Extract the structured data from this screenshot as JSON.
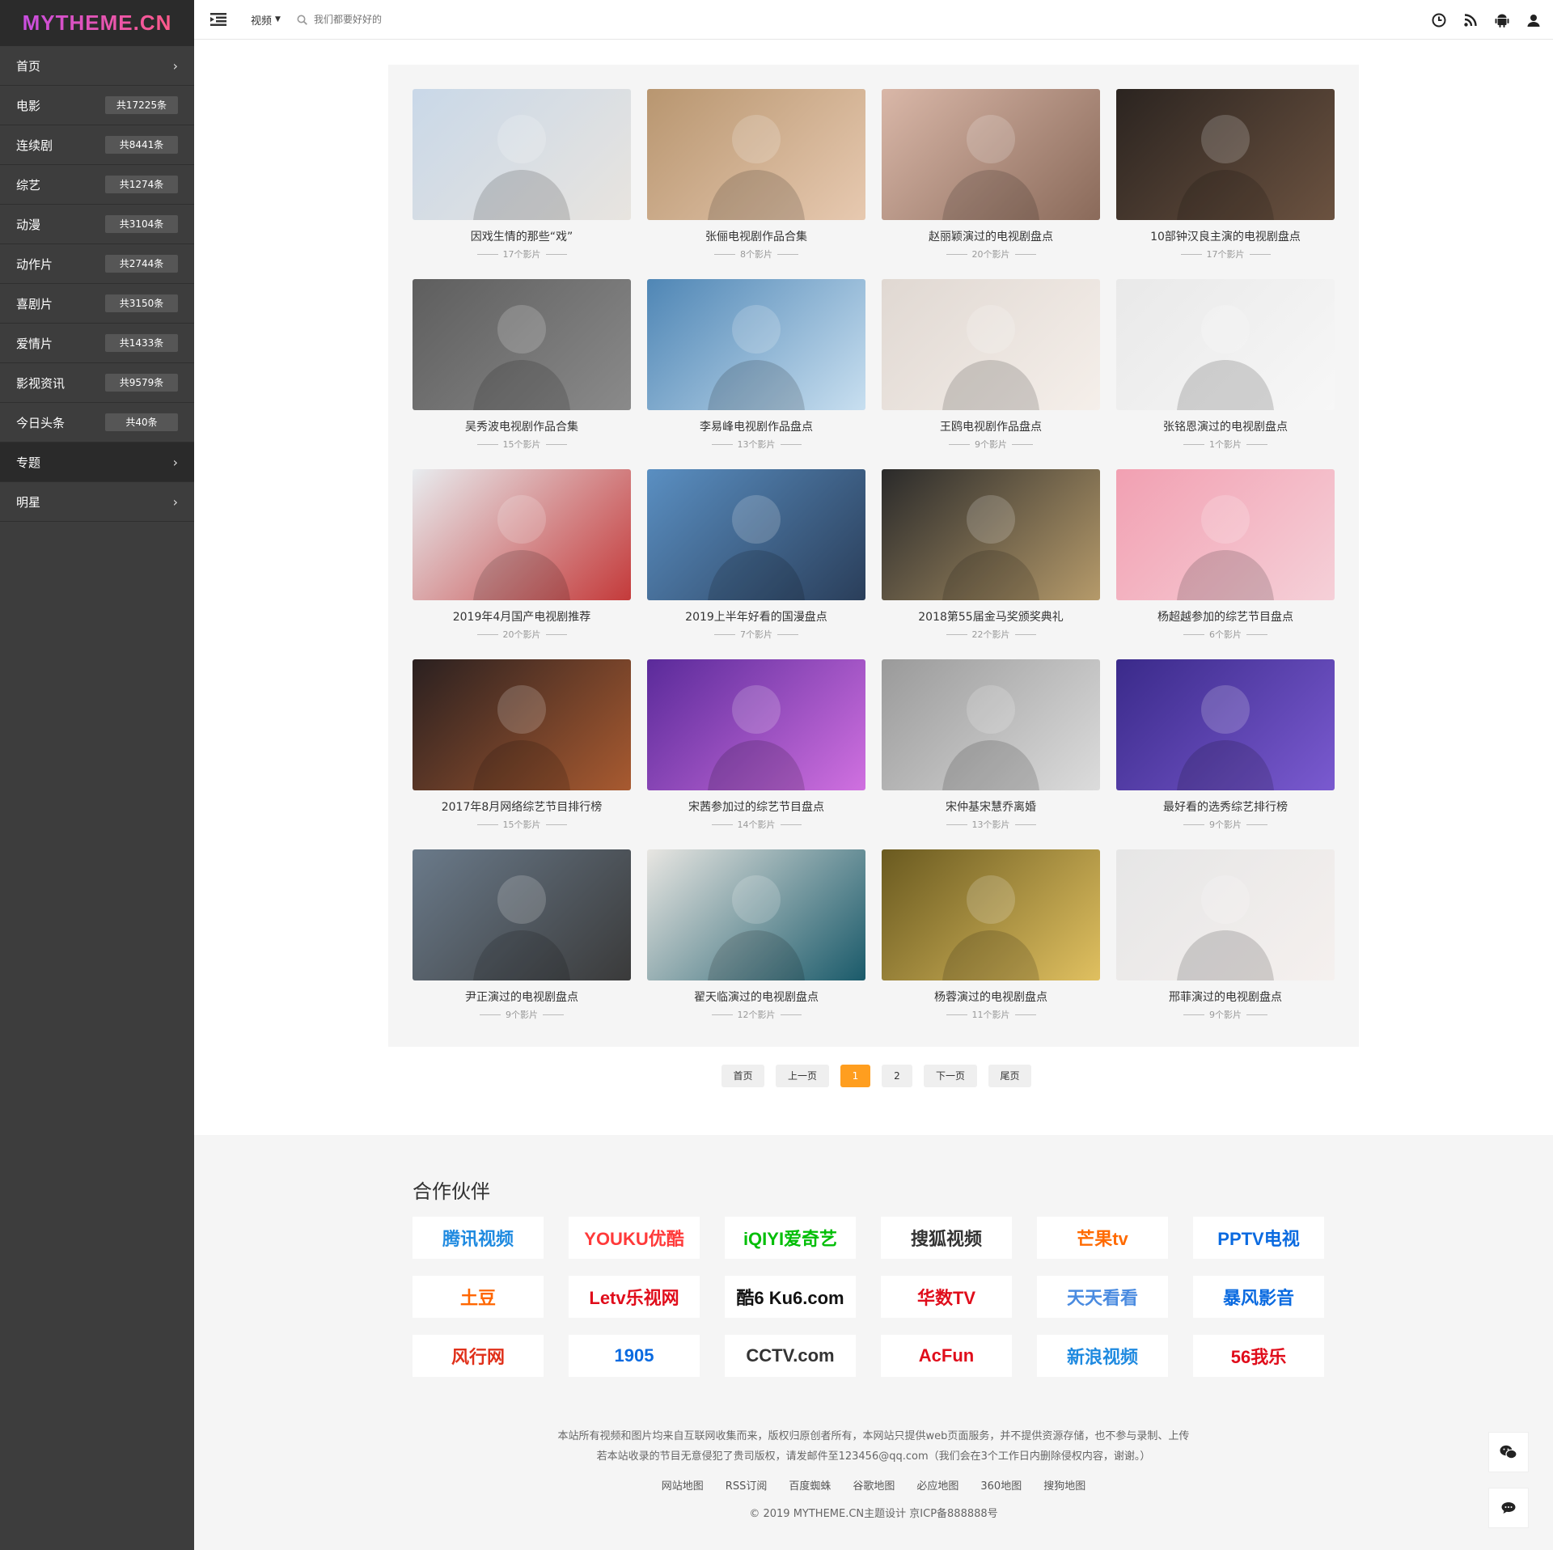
{
  "logo": "MYTHEME.CN",
  "sidebar": {
    "items": [
      {
        "label": "首页",
        "count": ""
      },
      {
        "label": "电影",
        "count": "共17225条"
      },
      {
        "label": "连续剧",
        "count": "共8441条"
      },
      {
        "label": "综艺",
        "count": "共1274条"
      },
      {
        "label": "动漫",
        "count": "共3104条"
      },
      {
        "label": "动作片",
        "count": "共2744条"
      },
      {
        "label": "喜剧片",
        "count": "共3150条"
      },
      {
        "label": "爱情片",
        "count": "共1433条"
      },
      {
        "label": "影视资讯",
        "count": "共9579条"
      },
      {
        "label": "今日头条",
        "count": "共40条"
      },
      {
        "label": "专题",
        "count": ""
      },
      {
        "label": "明星",
        "count": ""
      }
    ]
  },
  "topbar": {
    "category": "视频",
    "search_placeholder": "我们都要好好的"
  },
  "topics": [
    {
      "title": "因戏生情的那些“戏”",
      "count": "17个影片",
      "c1": "#c9d8e8",
      "c2": "#e8e4df"
    },
    {
      "title": "张俪电视剧作品合集",
      "count": "8个影片",
      "c1": "#b89670",
      "c2": "#e7c9b0"
    },
    {
      "title": "赵丽颖演过的电视剧盘点",
      "count": "20个影片",
      "c1": "#d9b7a8",
      "c2": "#8a6a5a"
    },
    {
      "title": "10部钟汉良主演的电视剧盘点",
      "count": "17个影片",
      "c1": "#2b2420",
      "c2": "#6b5240"
    },
    {
      "title": "吴秀波电视剧作品合集",
      "count": "15个影片",
      "c1": "#5e5e5e",
      "c2": "#8a8a8a"
    },
    {
      "title": "李易峰电视剧作品盘点",
      "count": "13个影片",
      "c1": "#4f86b5",
      "c2": "#c8dff0"
    },
    {
      "title": "王鸥电视剧作品盘点",
      "count": "9个影片",
      "c1": "#e0d8d2",
      "c2": "#f5efea"
    },
    {
      "title": "张铭恩演过的电视剧盘点",
      "count": "1个影片",
      "c1": "#e9e9e9",
      "c2": "#f7f7f7"
    },
    {
      "title": "2019年4月国产电视剧推荐",
      "count": "20个影片",
      "c1": "#e8ecef",
      "c2": "#c43a3a"
    },
    {
      "title": "2019上半年好看的国漫盘点",
      "count": "7个影片",
      "c1": "#5a8fc2",
      "c2": "#2a3e5a"
    },
    {
      "title": "2018第55届金马奖颁奖典礼",
      "count": "22个影片",
      "c1": "#2a2a2a",
      "c2": "#b59a6a"
    },
    {
      "title": "杨超越参加的综艺节目盘点",
      "count": "6个影片",
      "c1": "#f2a0b2",
      "c2": "#f5d0d8"
    },
    {
      "title": "2017年8月网络综艺节目排行榜",
      "count": "15个影片",
      "c1": "#2a2020",
      "c2": "#a85a30"
    },
    {
      "title": "宋茜参加过的综艺节目盘点",
      "count": "14个影片",
      "c1": "#5a2a9a",
      "c2": "#d070e0"
    },
    {
      "title": "宋仲基宋慧乔离婚",
      "count": "13个影片",
      "c1": "#9a9a9a",
      "c2": "#dcdcdc"
    },
    {
      "title": "最好看的选秀综艺排行榜",
      "count": "9个影片",
      "c1": "#3a2a8a",
      "c2": "#7a5ad0"
    },
    {
      "title": "尹正演过的电视剧盘点",
      "count": "9个影片",
      "c1": "#6a7a8a",
      "c2": "#3a3a3a"
    },
    {
      "title": "翟天临演过的电视剧盘点",
      "count": "12个影片",
      "c1": "#e8e6e2",
      "c2": "#1a5a6a"
    },
    {
      "title": "杨蓉演过的电视剧盘点",
      "count": "11个影片",
      "c1": "#6a5a20",
      "c2": "#e0c060"
    },
    {
      "title": "邢菲演过的电视剧盘点",
      "count": "9个影片",
      "c1": "#e6e6e6",
      "c2": "#f5f0ee"
    }
  ],
  "pagination": {
    "first": "首页",
    "prev": "上一页",
    "current": "1",
    "next_num": "2",
    "next": "下一页",
    "last": "尾页"
  },
  "partners_title": "合作伙伴",
  "partners": [
    {
      "name": "腾讯视频",
      "color": "#1f8ae0"
    },
    {
      "name": "YOUKU优酷",
      "color": "#ff3a3a"
    },
    {
      "name": "iQIYI爱奇艺",
      "color": "#00be06"
    },
    {
      "name": "搜狐视频",
      "color": "#333333"
    },
    {
      "name": "芒果tv",
      "color": "#ff6a00"
    },
    {
      "name": "PPTV电视",
      "color": "#0a6ae0"
    },
    {
      "name": "土豆",
      "color": "#ff6600"
    },
    {
      "name": "Letv乐视网",
      "color": "#e00d1b"
    },
    {
      "name": "酷6 Ku6.com",
      "color": "#111111"
    },
    {
      "name": "华数TV",
      "color": "#e00d1b"
    },
    {
      "name": "天天看看",
      "color": "#4a8be0"
    },
    {
      "name": "暴风影音",
      "color": "#0a6ae0"
    },
    {
      "name": "风行网",
      "color": "#e0301a"
    },
    {
      "name": "1905",
      "color": "#0a6ae0"
    },
    {
      "name": "CCTV.com",
      "color": "#333333"
    },
    {
      "name": "AcFun",
      "color": "#e00d1b"
    },
    {
      "name": "新浪视频",
      "color": "#1f8ae0"
    },
    {
      "name": "56我乐",
      "color": "#e00d1b"
    }
  ],
  "footer": {
    "disclaimer1": "本站所有视频和图片均来自互联网收集而来，版权归原创者所有，本网站只提供web页面服务，并不提供资源存储，也不参与录制、上传",
    "disclaimer2": "若本站收录的节目无意侵犯了贵司版权，请发邮件至123456@qq.com（我们会在3个工作日内删除侵权内容，谢谢。）",
    "links": [
      "网站地图",
      "RSS订阅",
      "百度蜘蛛",
      "谷歌地图",
      "必应地图",
      "360地图",
      "搜狗地图"
    ],
    "copyright": "© 2019 MYTHEME.CN主题设计 京ICP备888888号"
  }
}
